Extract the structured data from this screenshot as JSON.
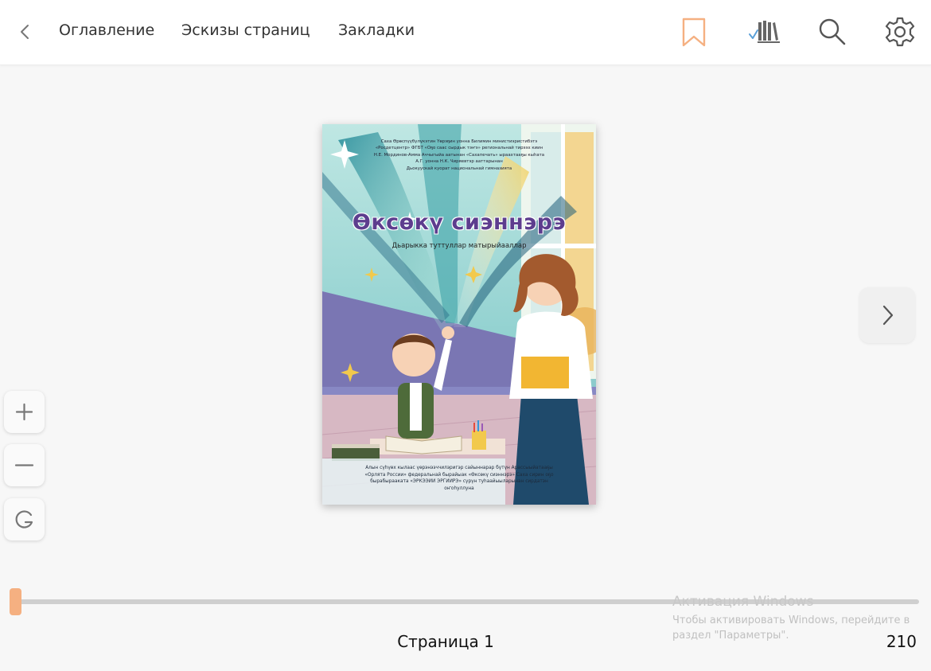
{
  "toolbar": {
    "nav": [
      "Оглавление",
      "Эскизы страниц",
      "Закладки"
    ],
    "icons": [
      "chevron-left-icon",
      "bookmark-icon",
      "library-icon",
      "search-icon",
      "gear-icon"
    ],
    "accent_color": "#f5b081"
  },
  "book": {
    "credits": [
      "Саха Өрөспүүбүлүкэтин Үөрэҕин уонна Билимин министиэристибэтэ",
      "«Росдетцентр» ФГБТ «Оҕо саас сырдык тэҥэ» региональнай тирээх киин",
      "Н.Е. Мординов-Амма Аччыгыйа аатынан «Сахапечать» ыраахтааҕы кыһата",
      "А.Г. уонна Н.К. Чиряевтэр ааттарынан",
      "Дьокуускай куорат национальнай гимназията"
    ],
    "title": "Өксөкү сиэннэрэ",
    "subtitle": "Дьарыкка туттуллар матырыйааллар",
    "bottom_text": [
      "Алын сүһүөх кылаас үөрэнээччилэригэр сайыннарар бүтүн Арассыыйатааҕы",
      "«Орлята России» федеральнай бырайыак «Өксөкү сиэннэрэ» Саха сирин оҕо",
      "бырабырааката «ЭРКЭЭЙИ ЭРГИИРЭ» сүрүн туһаайыыларынан сирдатэн",
      "оҥоһуллуна"
    ]
  },
  "viewer": {
    "progress": 0.005,
    "page_label": "Страница 1",
    "total_pages": "210"
  },
  "watermark": {
    "title": "Активация Windows",
    "text": "Чтобы активировать Windows, перейдите в раздел \"Параметры\"."
  }
}
